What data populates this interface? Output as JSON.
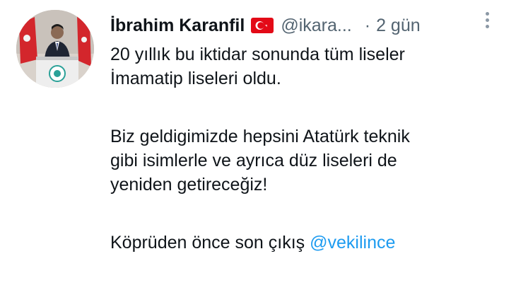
{
  "tweet": {
    "author": {
      "display_name": "İbrahim Karanfil",
      "handle": "@ikara...",
      "flag_icon": "turkey-flag-icon"
    },
    "separator": "·",
    "timestamp": "2 gün",
    "text_lines": {
      "line1": "20 yıllık bu iktidar sonunda tüm liseler",
      "line2": "İmamatip liseleri oldu.",
      "line3": "Biz geldigimizde hepsini Atatürk teknik",
      "line4": "gibi isimlerle ve ayrıca düz liseleri de",
      "line5": "yeniden getireceğiz!",
      "line6_prefix": "Köprüden önce son çıkış"
    },
    "mention": "@vekilince"
  },
  "colors": {
    "text": "#0f1419",
    "secondary": "#536471",
    "link": "#1d9bf0",
    "flag_red": "#e30a17"
  }
}
